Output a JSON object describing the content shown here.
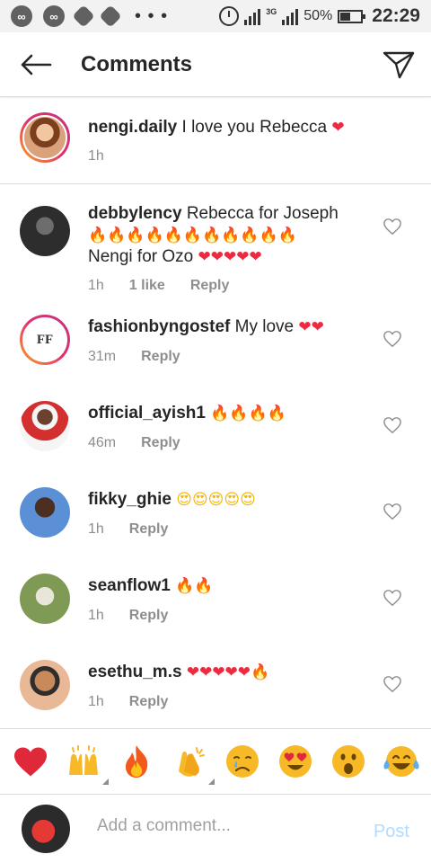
{
  "status_bar": {
    "battery": "50%",
    "battery_level": 0.5,
    "network": "3G",
    "time": "22:29"
  },
  "header": {
    "title": "Comments",
    "back_icon": "arrow-left-icon",
    "share_icon": "paper-plane-icon"
  },
  "caption": {
    "username": "nengi.daily",
    "text": "I love you Rebecca",
    "emoji": "❤",
    "time": "1h"
  },
  "comments": [
    {
      "username": "debbylency",
      "text": "Rebecca for Joseph",
      "line2": "🔥🔥🔥🔥🔥🔥🔥🔥🔥🔥🔥",
      "line3_text": "Nengi for Ozo",
      "line3_emoji": "❤❤❤❤❤",
      "time": "1h",
      "likes": "1 like",
      "reply": "Reply"
    },
    {
      "username": "fashionbyngostef",
      "text": "My love",
      "emoji": "❤❤",
      "time": "31m",
      "reply": "Reply"
    },
    {
      "username": "official_ayish1",
      "text": "",
      "emoji": "🔥🔥🔥🔥",
      "time": "46m",
      "reply": "Reply"
    },
    {
      "username": "fikky_ghie",
      "text": "",
      "emoji": "😍😍😍😍😍",
      "time": "1h",
      "reply": "Reply"
    },
    {
      "username": "seanflow1",
      "text": "",
      "emoji": "🔥🔥",
      "time": "1h",
      "reply": "Reply"
    },
    {
      "username": "esethu_m.s",
      "text": "",
      "emoji": "❤❤❤❤❤",
      "emoji2": "🔥",
      "time": "1h",
      "reply": "Reply"
    }
  ],
  "quick_emojis": [
    "red-heart",
    "raising-hands",
    "fire",
    "clapping-hands",
    "crying-face",
    "heart-eyes-face",
    "open-mouth-face",
    "tears-of-joy-face"
  ],
  "composer": {
    "placeholder": "Add a comment...",
    "post_label": "Post"
  },
  "colors": {
    "post_disabled": "#b3dbff",
    "heart_red": "#ed2a3f",
    "meta_grey": "#8e8e8e"
  }
}
